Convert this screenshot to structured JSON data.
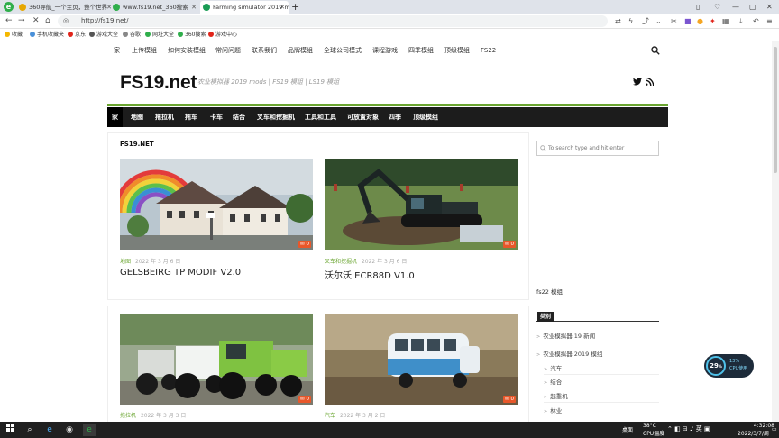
{
  "browser": {
    "tabs": [
      {
        "label": "360导航_一个主页，整个世界",
        "icon_color": "#e6a700"
      },
      {
        "label": "www.fs19.net_360搜索",
        "icon_color": "#2fae4b"
      },
      {
        "label": "Farming simulator 2019 mo",
        "icon_color": "#1a9c55",
        "active": true
      }
    ],
    "url": "http://fs19.net/",
    "bookmarks": [
      {
        "label": "收藏",
        "color": "#f5b800"
      },
      {
        "label": "手机收藏夹",
        "color": "#4a90d9"
      },
      {
        "label": "京东",
        "color": "#e1251b"
      },
      {
        "label": "游戏大全",
        "color": "#555555"
      },
      {
        "label": "谷歌",
        "color": "#888888"
      },
      {
        "label": "网址大全",
        "color": "#2fae4b"
      },
      {
        "label": "360搜索",
        "color": "#2fae4b"
      },
      {
        "label": "游戏中心",
        "color": "#e1251b"
      }
    ]
  },
  "site": {
    "top_nav": [
      "家",
      "上传模组",
      "如何安装模组",
      "常问问题",
      "联系我们",
      "品牌模组",
      "全球公司模式",
      "课程游戏",
      "四季模组",
      "顶级模组",
      "FS22"
    ],
    "brand": "FS19.net",
    "tagline": "农业模拟器 2019 mods | FS19 模组 | LS19 模组",
    "main_nav": [
      "家",
      "地图",
      "拖拉机",
      "拖车",
      "卡车",
      "结合",
      "叉车和挖掘机",
      "工具和工具",
      "可放置对象",
      "四季",
      "顶级模组"
    ],
    "section_title": "FS19.NET",
    "posts": [
      {
        "category": "地图",
        "date": "2022 年 3 月 6 日",
        "title": "GELSBEIRG TP MODIF V2.0",
        "comments": "0"
      },
      {
        "category": "叉车和挖掘机",
        "date": "2022 年 3 月 6 日",
        "title": "沃尔沃 ECR88D V1.0",
        "comments": "0"
      },
      {
        "category": "拖拉机",
        "date": "2022 年 3 月 3 日",
        "title": "",
        "comments": "0"
      },
      {
        "category": "汽车",
        "date": "2022 年 3 月 2 日",
        "title": "",
        "comments": "0"
      }
    ],
    "sidebar": {
      "search_placeholder": "To search type and hit enter",
      "fs22_link": "fs22 模组",
      "categories_heading": "类别",
      "categories": [
        {
          "label": "农业模拟器 19 新闻",
          "level": 0
        },
        {
          "label": "农业模拟器 2019 模组",
          "level": 0
        },
        {
          "label": "汽车",
          "level": 1
        },
        {
          "label": "结合",
          "level": 1
        },
        {
          "label": "起重机",
          "level": 1
        },
        {
          "label": "林业",
          "level": 1
        }
      ]
    }
  },
  "overlay": {
    "cpu_percent": "29",
    "cpu_percent_unit": "%",
    "mem": "13%",
    "mem_label": "CPU使用"
  },
  "taskbar": {
    "weather_label": "桌面",
    "temp": "38°C",
    "temp_label": "CPU温度",
    "time": "4:32:08",
    "date": "2022/3/7/周一"
  },
  "colors": {
    "accent_green": "#6aa530",
    "nav_dark": "#1c1c1c",
    "comment_orange": "#e8572a"
  }
}
